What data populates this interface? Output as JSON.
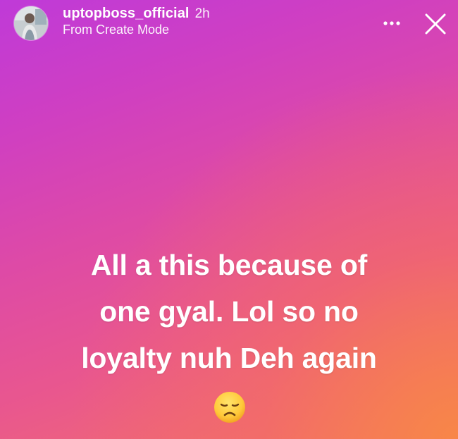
{
  "story": {
    "username": "uptopboss_official",
    "time_ago": "2h",
    "subtitle": "From Create Mode",
    "caption_lines": [
      "All a this because of",
      "one gyal. Lol so no",
      "loyalty nuh Deh again"
    ],
    "emoji": "disappointed-face",
    "colors": {
      "gradient_top_left": "#bf3ad8",
      "gradient_mid": "#e9578e",
      "gradient_bottom_right": "#f37b63",
      "text": "#ffffff"
    }
  },
  "icons": {
    "more": "more-horizontal-icon",
    "close": "close-icon",
    "avatar": "profile-avatar"
  }
}
